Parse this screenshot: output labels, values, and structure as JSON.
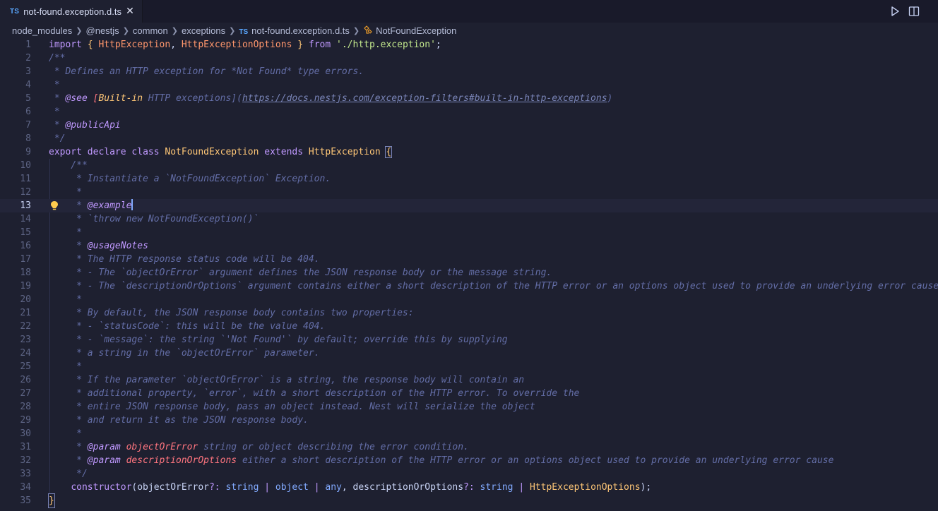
{
  "tab": {
    "lang_badge": "TS",
    "filename": "not-found.exception.d.ts",
    "close_glyph": "✕"
  },
  "actions": {
    "run_icon": "play-icon",
    "split_icon": "split-editor-icon"
  },
  "breadcrumb": {
    "items": [
      "node_modules",
      "@nestjs",
      "common",
      "exceptions"
    ],
    "file_badge": "TS",
    "file": "not-found.exception.d.ts",
    "symbol": "NotFoundException"
  },
  "editor": {
    "current_line": 13,
    "line_numbers": [
      "1",
      "2",
      "3",
      "4",
      "5",
      "6",
      "7",
      "8",
      "9",
      "10",
      "11",
      "12",
      "13",
      "14",
      "15",
      "16",
      "17",
      "18",
      "19",
      "20",
      "21",
      "22",
      "23",
      "24",
      "25",
      "26",
      "27",
      "28",
      "29",
      "30",
      "31",
      "32",
      "33",
      "34",
      "35"
    ],
    "code": {
      "l1": {
        "import": "import",
        "open": "{",
        "t1": "HttpException",
        "comma": ",",
        "t2": "HttpExceptionOptions",
        "close": "}",
        "from": "from",
        "str": "'./http.exception'",
        "semi": ";"
      },
      "l2": "/**",
      "l3": " * Defines an HTTP exception for *Not Found* type errors.",
      "l4": " *",
      "l5": {
        "pre": " * ",
        "tag": "@see",
        "sp": " ",
        "lb": "[",
        "bi": "Built-in",
        "mid": " HTTP exceptions](",
        "url": "https://docs.nestjs.com/exception-filters#built-in-http-exceptions",
        "end": ")"
      },
      "l6": " *",
      "l7": {
        "pre": " * ",
        "tag": "@publicApi"
      },
      "l8": " */",
      "l9": {
        "export": "export",
        "declare": "declare",
        "class": "class",
        "name": "NotFoundException",
        "extends": "extends",
        "base": "HttpException",
        "brace": "{"
      },
      "l10": "    /**",
      "l11": "     * Instantiate a `NotFoundException` Exception.",
      "l12": "     *",
      "l13": {
        "pre": "     * ",
        "tag": "@example"
      },
      "l14": "     * `throw new NotFoundException()`",
      "l15": "     *",
      "l16": {
        "pre": "     * ",
        "tag": "@usageNotes"
      },
      "l17": "     * The HTTP response status code will be 404.",
      "l18": "     * - The `objectOrError` argument defines the JSON response body or the message string.",
      "l19": "     * - The `descriptionOrOptions` argument contains either a short description of the HTTP error or an options object used to provide an underlying error cause.",
      "l20": "     *",
      "l21": "     * By default, the JSON response body contains two properties:",
      "l22": "     * - `statusCode`: this will be the value 404.",
      "l23": "     * - `message`: the string `'Not Found'` by default; override this by supplying",
      "l24": "     * a string in the `objectOrError` parameter.",
      "l25": "     *",
      "l26": "     * If the parameter `objectOrError` is a string, the response body will contain an",
      "l27": "     * additional property, `error`, with a short description of the HTTP error. To override the",
      "l28": "     * entire JSON response body, pass an object instead. Nest will serialize the object",
      "l29": "     * and return it as the JSON response body.",
      "l30": "     *",
      "l31": {
        "pre": "     * ",
        "tag": "@param",
        "name": "objectOrError",
        "desc": " string or object describing the error condition."
      },
      "l32": {
        "pre": "     * ",
        "tag": "@param",
        "name": "descriptionOrOptions",
        "desc": " either a short description of the HTTP error or an options object used to provide an underlying error cause"
      },
      "l33": "     */",
      "l34": {
        "indent": "    ",
        "ctor": "constructor",
        "p1": "(objectOrError",
        "q1": "?:",
        "s1": "string",
        "bar1": "|",
        "o1": "object",
        "bar2": "|",
        "a1": "any",
        "p2": ", descriptionOrOptions",
        "q2": "?:",
        "s2": "string",
        "bar3": "|",
        "t3": "HttpExceptionOptions",
        "end": ");"
      },
      "l35": "}"
    }
  },
  "colors": {
    "background": "#1e2030",
    "keyword": "#c099ff",
    "type": "#ffc777",
    "string": "#c3e88d",
    "comment": "#636da6",
    "tag_name": "#ff757f"
  }
}
